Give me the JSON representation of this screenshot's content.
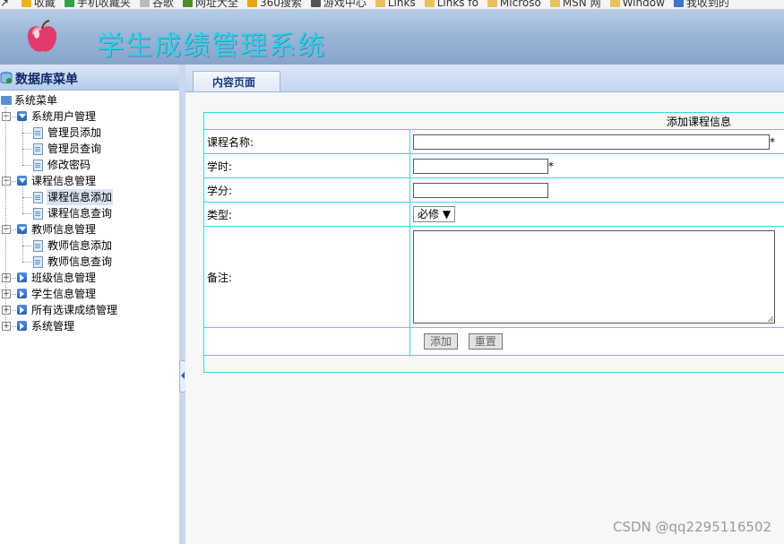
{
  "bookmarks": [
    {
      "label": "收藏",
      "icon": "star-icon",
      "color": "#e9b41b"
    },
    {
      "label": "手机收藏夹",
      "icon": "phone-icon",
      "color": "#36a14b"
    },
    {
      "label": "谷歌",
      "icon": "page-icon",
      "color": "#bbbbbb"
    },
    {
      "label": "网址大全",
      "icon": "globe-icon",
      "color": "#4a8f2a"
    },
    {
      "label": "360搜索",
      "icon": "search-icon",
      "color": "#e8a515"
    },
    {
      "label": "游戏中心",
      "icon": "gamepad-icon",
      "color": "#555555"
    },
    {
      "label": "Links",
      "icon": "folder-icon",
      "color": "#e8c25a"
    },
    {
      "label": "Links fo",
      "icon": "folder-icon",
      "color": "#e8c25a"
    },
    {
      "label": "Microso",
      "icon": "folder-icon",
      "color": "#e8c25a"
    },
    {
      "label": "MSN 网",
      "icon": "folder-icon",
      "color": "#e8c25a"
    },
    {
      "label": "Window",
      "icon": "folder-icon",
      "color": "#e8c25a"
    },
    {
      "label": "我收到的",
      "icon": "search-icon",
      "color": "#3a73c8"
    }
  ],
  "app": {
    "title": "学生成绩管理系统"
  },
  "sidebar": {
    "title": "数据库菜单",
    "root": "系统菜单",
    "groups": [
      {
        "label": "系统用户管理",
        "items": [
          "管理员添加",
          "管理员查询",
          "修改密码"
        ]
      },
      {
        "label": "课程信息管理",
        "items": [
          "课程信息添加",
          "课程信息查询"
        ]
      },
      {
        "label": "教师信息管理",
        "items": [
          "教师信息添加",
          "教师信息查询"
        ]
      },
      {
        "label": "班级信息管理",
        "items": []
      },
      {
        "label": "学生信息管理",
        "items": []
      },
      {
        "label": "所有选课成绩管理",
        "items": []
      },
      {
        "label": "系统管理",
        "items": []
      }
    ]
  },
  "main": {
    "tab": "内容页面",
    "form": {
      "caption": "添加课程信息",
      "course_name_label": "课程名称:",
      "course_name_value": "",
      "hours_label": "学时:",
      "hours_value": "",
      "credit_label": "学分:",
      "credit_value": "",
      "type_label": "类型:",
      "type_value": "必修",
      "note_label": "备注:",
      "note_value": "",
      "required_mark": "*",
      "add_button": "添加",
      "reset_button": "重置"
    }
  },
  "watermark": "CSDN @qq2295116502"
}
